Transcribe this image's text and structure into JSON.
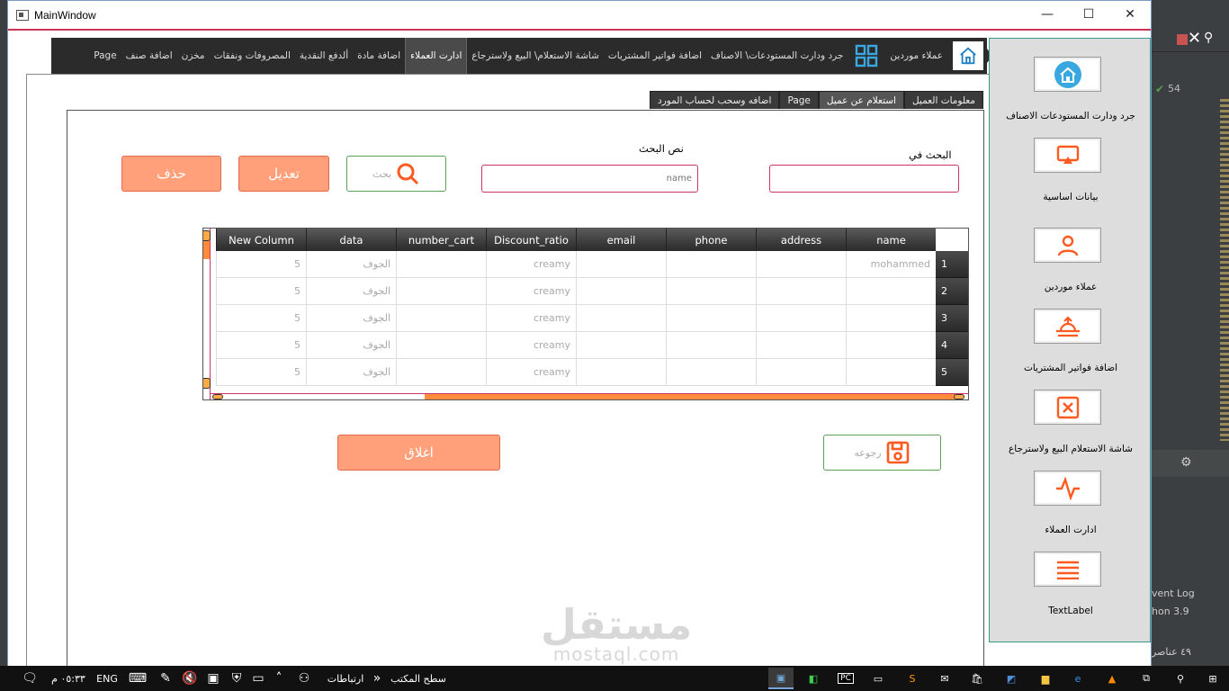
{
  "window": {
    "title": "MainWindow",
    "minimize": "—",
    "maximize": "☐",
    "close": "✕"
  },
  "topnav": {
    "items": [
      "عملاء موردين",
      "جرد ودارت المستودعات\\ الاصناف",
      "اضافة فواتير المشتريات",
      "شاشة الاستعلام\\ البيع ولاسترجاع",
      "ادارت العملاء",
      "اضافة مادة",
      "ألدفع النقدية",
      "المصروفات ونفقات",
      "مخزن",
      "اضافة صنف",
      "Page"
    ]
  },
  "tabs": [
    "معلومات العميل",
    "استعلام عن عميل",
    "Page",
    "اضافه وسحب لحساب المورد"
  ],
  "form": {
    "search_in_label": "البحث في",
    "search_text_label": "نص البحث",
    "search_text_placeholder": "name",
    "search_button": "بحث",
    "edit_button": "تعديل",
    "delete_button": "حذف",
    "save_button": "رجوعه",
    "close_button": "اغلاق"
  },
  "table": {
    "columns": [
      "name",
      "address",
      "phone",
      "email",
      "Discount_ratio",
      "number_cart",
      "data",
      "New Column"
    ],
    "rows": [
      {
        "num": "1",
        "cells": [
          "mohammed",
          "",
          "",
          "",
          "creamy",
          "",
          "الجوف",
          "5"
        ]
      },
      {
        "num": "2",
        "cells": [
          "",
          "",
          "",
          "",
          "creamy",
          "",
          "الجوف",
          "5"
        ]
      },
      {
        "num": "3",
        "cells": [
          "",
          "",
          "",
          "",
          "creamy",
          "",
          "الجوف",
          "5"
        ]
      },
      {
        "num": "4",
        "cells": [
          "",
          "",
          "",
          "",
          "creamy",
          "",
          "الجوف",
          "5"
        ]
      },
      {
        "num": "5",
        "cells": [
          "",
          "",
          "",
          "",
          "creamy",
          "",
          "الجوف",
          "5"
        ]
      }
    ]
  },
  "sidebar": {
    "items": [
      {
        "label": "جرد ودارت المستودعات   الاصناف",
        "icon": "home-icon"
      },
      {
        "label": "بيانات اساسية",
        "icon": "cast-icon"
      },
      {
        "label": "عملاء موردين",
        "icon": "user-icon"
      },
      {
        "label": "اضافة فواتير المشتريات",
        "icon": "sunrise-icon"
      },
      {
        "label": "شاشة الاستعلام  البيع ولاسترجاع",
        "icon": "x-square-icon"
      },
      {
        "label": "ادارت العملاء",
        "icon": "activity-icon"
      },
      {
        "label": "TextLabel",
        "icon": "menu-icon"
      }
    ]
  },
  "watermark": {
    "arabic": "مستقل",
    "latin": "mostaql.com"
  },
  "ide": {
    "count": "54",
    "event_log": "vent Log",
    "python": "hon 3.9",
    "items": "٤٩ عناصر"
  },
  "taskbar": {
    "time": "٠٥:٣٣ م",
    "lang": "ENG",
    "desktop": "سطح المكتب",
    "links": "ارتباطات"
  },
  "colors": {
    "accent_orange": "#ff8c3c",
    "button_fill": "#ffa07a",
    "nav_dark": "#2b2b2b",
    "input_border": "#cc3366"
  }
}
